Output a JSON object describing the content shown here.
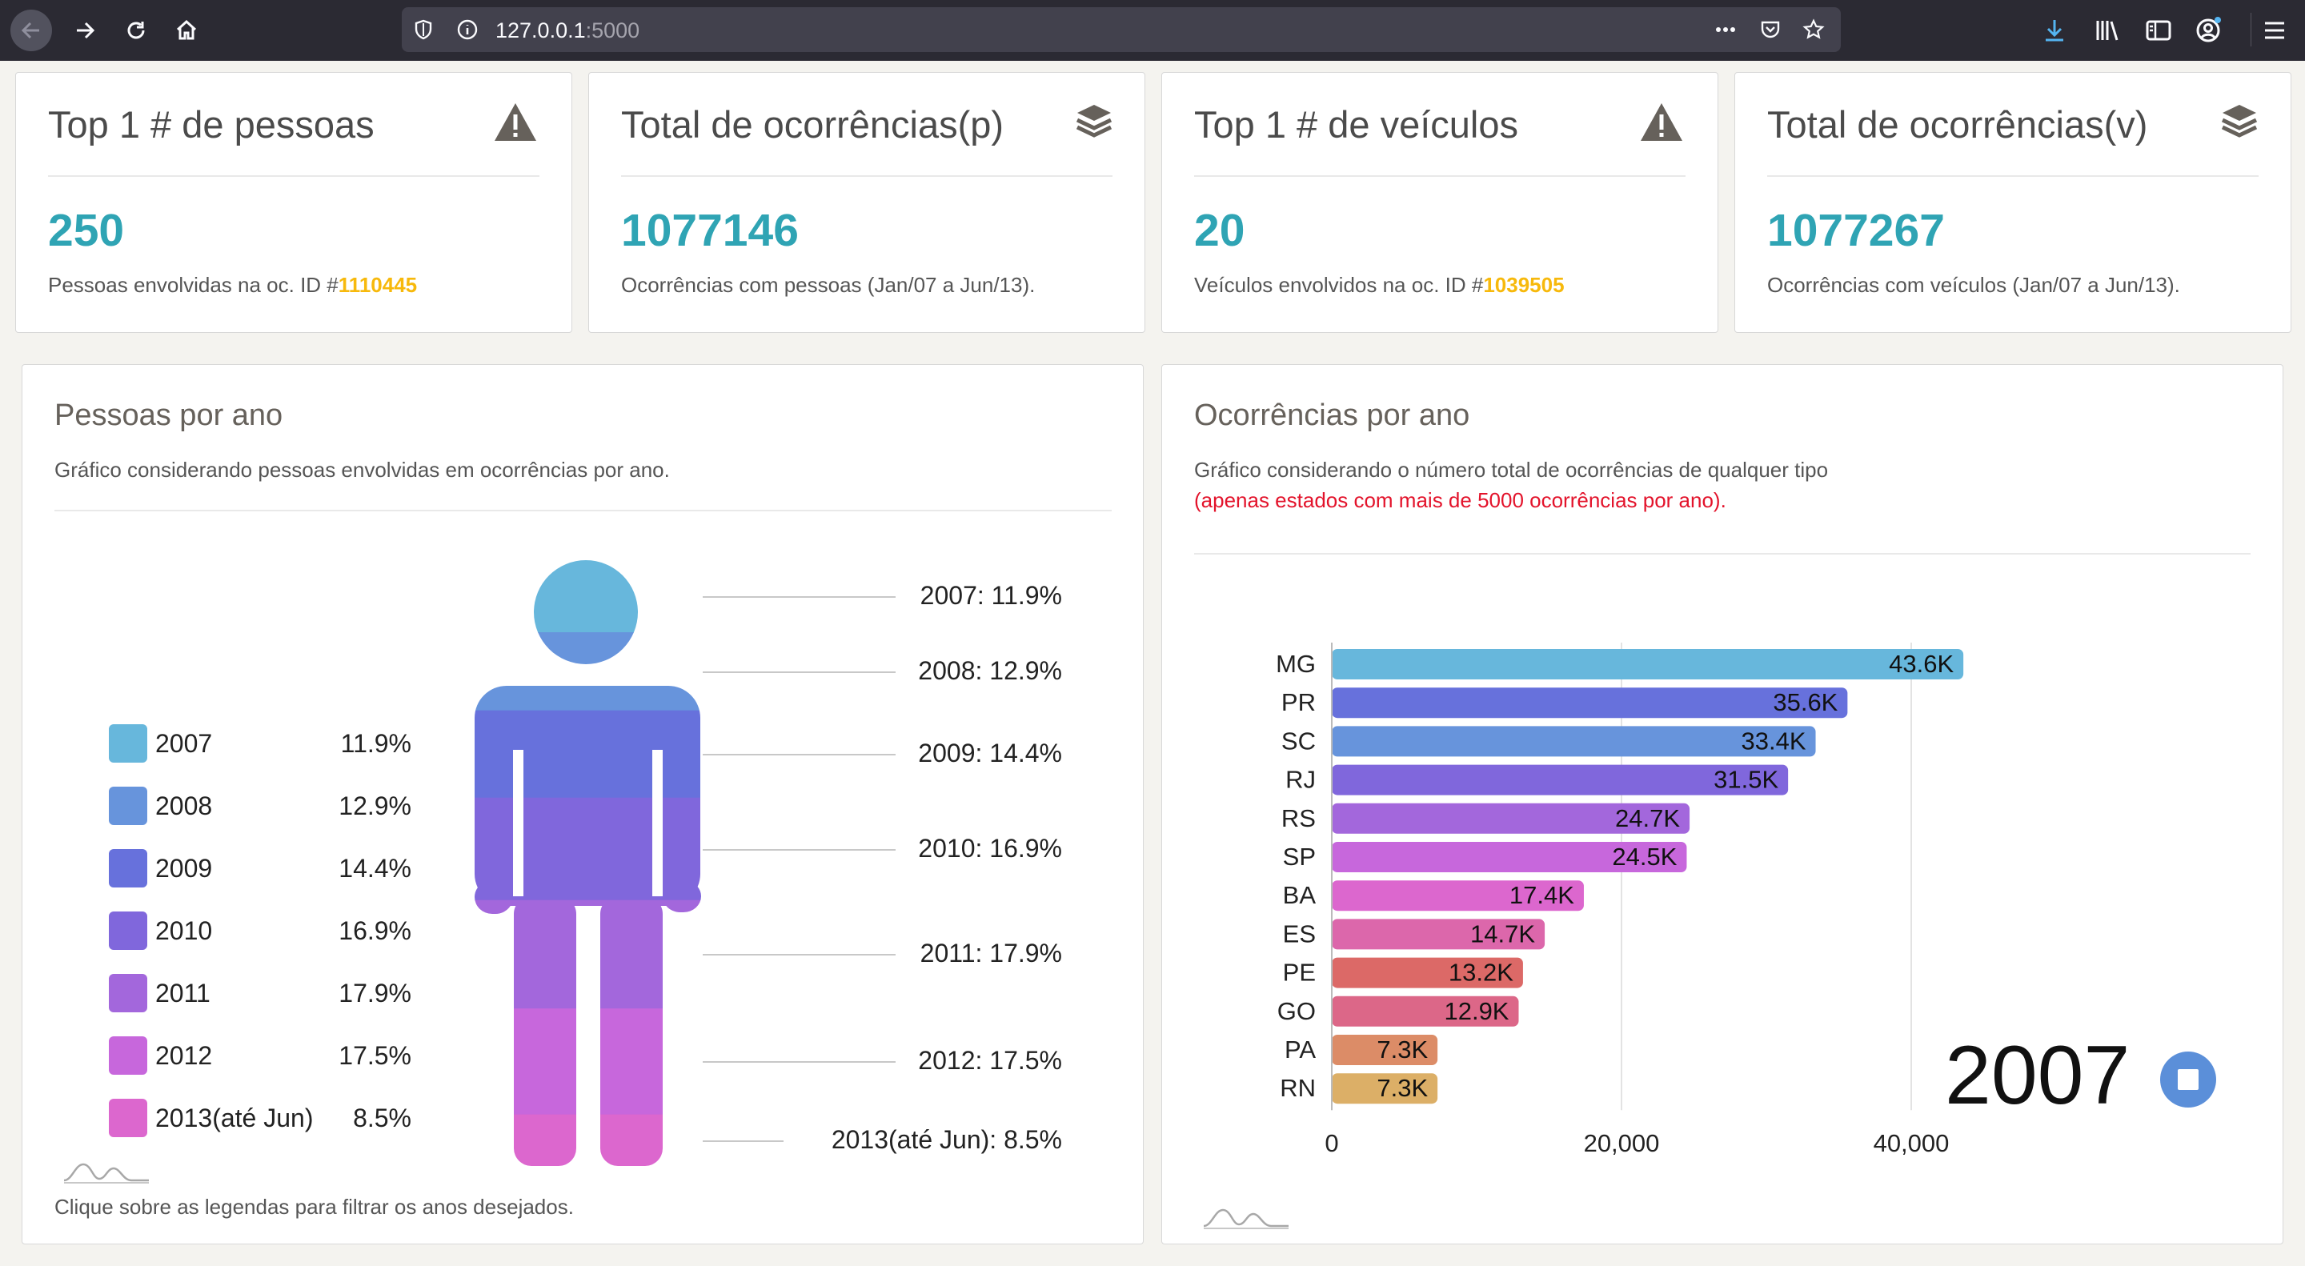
{
  "browser": {
    "url_host": "127.0.0.1",
    "url_port": ":5000"
  },
  "stats": [
    {
      "title": "Top 1 # de pessoas",
      "value": "250",
      "sub": "Pessoas envolvidas na oc. ID #",
      "highlight": "1110445",
      "icon": "warning-icon"
    },
    {
      "title": "Total de ocorrências(p)",
      "value": "1077146",
      "sub": "Ocorrências com pessoas (Jan/07 a Jun/13).",
      "icon": "layers-icon"
    },
    {
      "title": "Top 1 # de veículos",
      "value": "20",
      "sub": "Veículos envolvidos na oc. ID #",
      "highlight": "1039505",
      "icon": "warning-icon"
    },
    {
      "title": "Total de ocorrências(v)",
      "value": "1077267",
      "sub": "Ocorrências com veículos (Jan/07 a Jun/13).",
      "icon": "layers-icon"
    }
  ],
  "people_panel": {
    "title": "Pessoas por ano",
    "description": "Gráfico considerando pessoas envolvidas em ocorrências por ano.",
    "footer": "Clique sobre as legendas para filtrar os anos desejados.",
    "legend": [
      {
        "year": "2007",
        "pct": "11.9%",
        "color": "#67b7dc"
      },
      {
        "year": "2008",
        "pct": "12.9%",
        "color": "#6794dc"
      },
      {
        "year": "2009",
        "pct": "14.4%",
        "color": "#6771dc"
      },
      {
        "year": "2010",
        "pct": "16.9%",
        "color": "#8067dc"
      },
      {
        "year": "2011",
        "pct": "17.9%",
        "color": "#a367dc"
      },
      {
        "year": "2012",
        "pct": "17.5%",
        "color": "#c767dc"
      },
      {
        "year": "2013(até Jun)",
        "pct": "8.5%",
        "color": "#dc67ce"
      }
    ],
    "callouts": [
      "2007: 11.9%",
      "2008: 12.9%",
      "2009: 14.4%",
      "2010: 16.9%",
      "2011: 17.9%",
      "2012: 17.5%",
      "2013(até Jun): 8.5%"
    ]
  },
  "occurrences_panel": {
    "title": "Ocorrências por ano",
    "description": "Gráfico considerando o número total de ocorrências de qualquer tipo",
    "note": "(apenas estados com mais de 5000 ocorrências por ano).",
    "current_year": "2007"
  },
  "chart_data": [
    {
      "type": "pie",
      "categories": [
        "2007",
        "2008",
        "2009",
        "2010",
        "2011",
        "2012",
        "2013(até Jun)"
      ],
      "values": [
        11.9,
        12.9,
        14.4,
        16.9,
        17.9,
        17.5,
        8.5
      ],
      "unit": "%"
    },
    {
      "type": "bar",
      "orientation": "horizontal",
      "year": "2007",
      "categories": [
        "MG",
        "PR",
        "SC",
        "RJ",
        "RS",
        "SP",
        "BA",
        "ES",
        "PE",
        "GO",
        "PA",
        "RN"
      ],
      "values": [
        43600,
        35600,
        33400,
        31500,
        24700,
        24500,
        17400,
        14700,
        13200,
        12900,
        7300,
        7300
      ],
      "labels": [
        "43.6K",
        "35.6K",
        "33.4K",
        "31.5K",
        "24.7K",
        "24.5K",
        "17.4K",
        "14.7K",
        "13.2K",
        "12.9K",
        "7.3K",
        "7.3K"
      ],
      "colors": [
        "#67b7dc",
        "#6771dc",
        "#6794dc",
        "#8067dc",
        "#a367dc",
        "#c767dc",
        "#dc67ce",
        "#dc67ab",
        "#dc6967",
        "#dc6788",
        "#dc8c67",
        "#dcaf67"
      ],
      "xticks": [
        "0",
        "20,000",
        "40,000"
      ],
      "xlim": [
        0,
        50000
      ],
      "grid": true
    }
  ]
}
